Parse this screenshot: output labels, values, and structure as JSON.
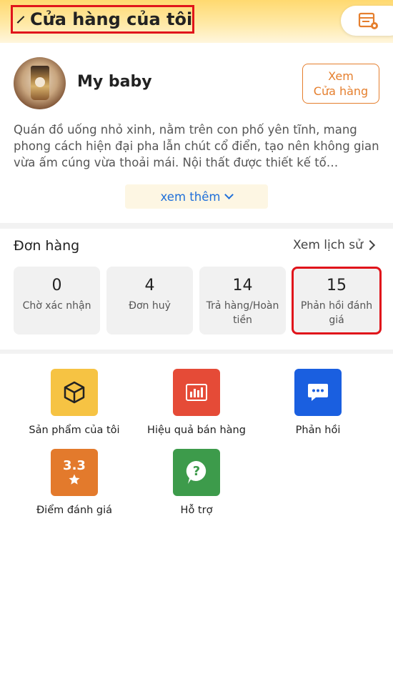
{
  "header": {
    "title": "Cửa hàng của tôi"
  },
  "profile": {
    "shop_name": "My baby",
    "view_shop_line1": "Xem",
    "view_shop_line2": "Cửa hàng",
    "description": "Quán đồ uống nhỏ xinh, nằm trên con phố yên tĩnh, mang phong cách hiện đại pha lẫn chút cổ điển, tạo nên không gian vừa ấm cúng vừa thoải mái. Nội thất được thiết kế tố…",
    "see_more": "xem thêm"
  },
  "orders": {
    "title": "Đơn hàng",
    "history": "Xem lịch sử",
    "stats": [
      {
        "value": "0",
        "label": "Chờ xác nhận"
      },
      {
        "value": "4",
        "label": "Đơn huỷ"
      },
      {
        "value": "14",
        "label": "Trả hàng/Hoàn tiền"
      },
      {
        "value": "15",
        "label": "Phản hồi đánh giá"
      }
    ]
  },
  "features": [
    {
      "label": "Sản phẩm của tôi",
      "icon": "box-icon",
      "color": "#f6c343"
    },
    {
      "label": "Hiệu quả bán hàng",
      "icon": "bar-chart-icon",
      "color": "#e54b37"
    },
    {
      "label": "Phản hồi",
      "icon": "chat-bubble-icon",
      "color": "#1a5fe0"
    },
    {
      "label": "Điểm đánh giá",
      "icon": "rating-star-icon",
      "rating": "3.3",
      "color": "#e37a2c"
    },
    {
      "label": "Hỗ trợ",
      "icon": "help-icon",
      "color": "#3d9b4b"
    }
  ]
}
